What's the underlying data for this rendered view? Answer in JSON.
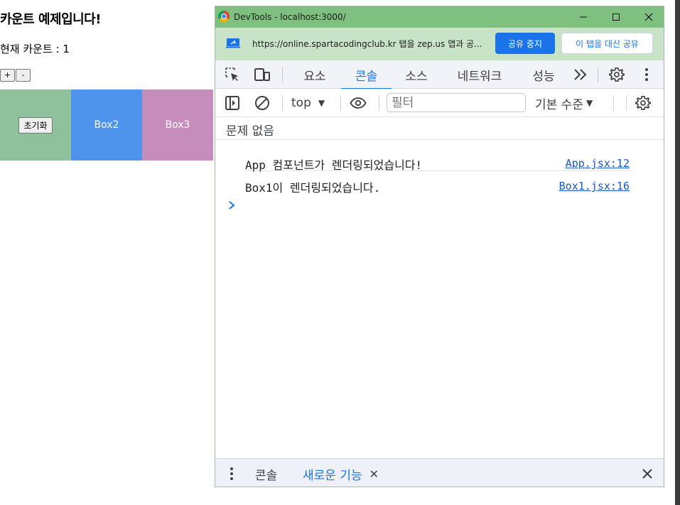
{
  "app": {
    "title": "카운트 예제입니다!",
    "count_text": "현재 카운트 : 1",
    "plus_label": "+",
    "minus_label": "-",
    "reset_label": "초기화",
    "box2_label": "Box2",
    "box3_label": "Box3",
    "colors": {
      "box1": "#8fc19c",
      "box2": "#4e93ec",
      "box3": "#c58cbc"
    }
  },
  "devtools": {
    "window_title": "DevTools - localhost:3000/",
    "share_text": "https://online.spartacodingclub.kr 탭을 zep.us 앱과 공...",
    "stop_sharing_label": "공유 중지",
    "share_this_tab_label": "이 탭을 대신 공유",
    "tabs": [
      "요소",
      "콘솔",
      "소스",
      "네트워크",
      "성능"
    ],
    "active_tab": "콘솔",
    "context": "top",
    "filter_placeholder": "필터",
    "level": "기본 수준",
    "issues_text": "문제 없음",
    "logs": [
      {
        "message": "App 컴포넌트가 렌더링되었습니다!",
        "source": "App.jsx:12"
      },
      {
        "message": "Box1이 렌더링되었습니다.",
        "source": "Box1.jsx:16"
      }
    ],
    "drawer_tabs": [
      "콘솔",
      "새로운 기능"
    ],
    "accent": "#1a73e8",
    "titlebar_color": "#7fbf7f"
  }
}
